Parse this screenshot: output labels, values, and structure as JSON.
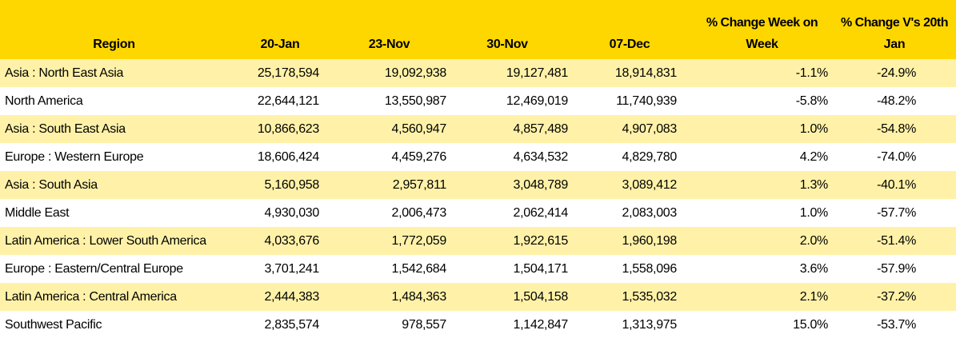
{
  "table": {
    "header_row1": {
      "col_wow": "% Change Week on",
      "col_v20": "% Change V's 20th"
    },
    "header_row2": {
      "region": "Region",
      "jan20": "20-Jan",
      "nov23": "23-Nov",
      "nov30": "30-Nov",
      "dec07": "07-Dec",
      "col_wow": "Week",
      "col_v20": "Jan"
    },
    "rows": [
      {
        "region": "Asia : North East Asia",
        "jan20": "25,178,594",
        "nov23": "19,092,938",
        "nov30": "19,127,481",
        "dec07": "18,914,831",
        "wow": "-1.1%",
        "v20": "-24.9%"
      },
      {
        "region": "North America",
        "jan20": "22,644,121",
        "nov23": "13,550,987",
        "nov30": "12,469,019",
        "dec07": "11,740,939",
        "wow": "-5.8%",
        "v20": "-48.2%"
      },
      {
        "region": "Asia : South East Asia",
        "jan20": "10,866,623",
        "nov23": "4,560,947",
        "nov30": "4,857,489",
        "dec07": "4,907,083",
        "wow": "1.0%",
        "v20": "-54.8%"
      },
      {
        "region": "Europe : Western Europe",
        "jan20": "18,606,424",
        "nov23": "4,459,276",
        "nov30": "4,634,532",
        "dec07": "4,829,780",
        "wow": "4.2%",
        "v20": "-74.0%"
      },
      {
        "region": "Asia : South Asia",
        "jan20": "5,160,958",
        "nov23": "2,957,811",
        "nov30": "3,048,789",
        "dec07": "3,089,412",
        "wow": "1.3%",
        "v20": "-40.1%"
      },
      {
        "region": "Middle East",
        "jan20": "4,930,030",
        "nov23": "2,006,473",
        "nov30": "2,062,414",
        "dec07": "2,083,003",
        "wow": "1.0%",
        "v20": "-57.7%"
      },
      {
        "region": "Latin America : Lower South America",
        "jan20": "4,033,676",
        "nov23": "1,772,059",
        "nov30": "1,922,615",
        "dec07": "1,960,198",
        "wow": "2.0%",
        "v20": "-51.4%"
      },
      {
        "region": "Europe : Eastern/Central Europe",
        "jan20": "3,701,241",
        "nov23": "1,542,684",
        "nov30": "1,504,171",
        "dec07": "1,558,096",
        "wow": "3.6%",
        "v20": "-57.9%"
      },
      {
        "region": "Latin America : Central America",
        "jan20": "2,444,383",
        "nov23": "1,484,363",
        "nov30": "1,504,158",
        "dec07": "1,535,032",
        "wow": "2.1%",
        "v20": "-37.2%"
      },
      {
        "region": "Southwest Pacific",
        "jan20": "2,835,574",
        "nov23": "978,557",
        "nov30": "1,142,847",
        "dec07": "1,313,975",
        "wow": "15.0%",
        "v20": "-53.7%"
      }
    ]
  },
  "colors": {
    "header_bg": "#ffd700",
    "band_bg": "#fff2a8",
    "plain_bg": "#ffffff"
  }
}
